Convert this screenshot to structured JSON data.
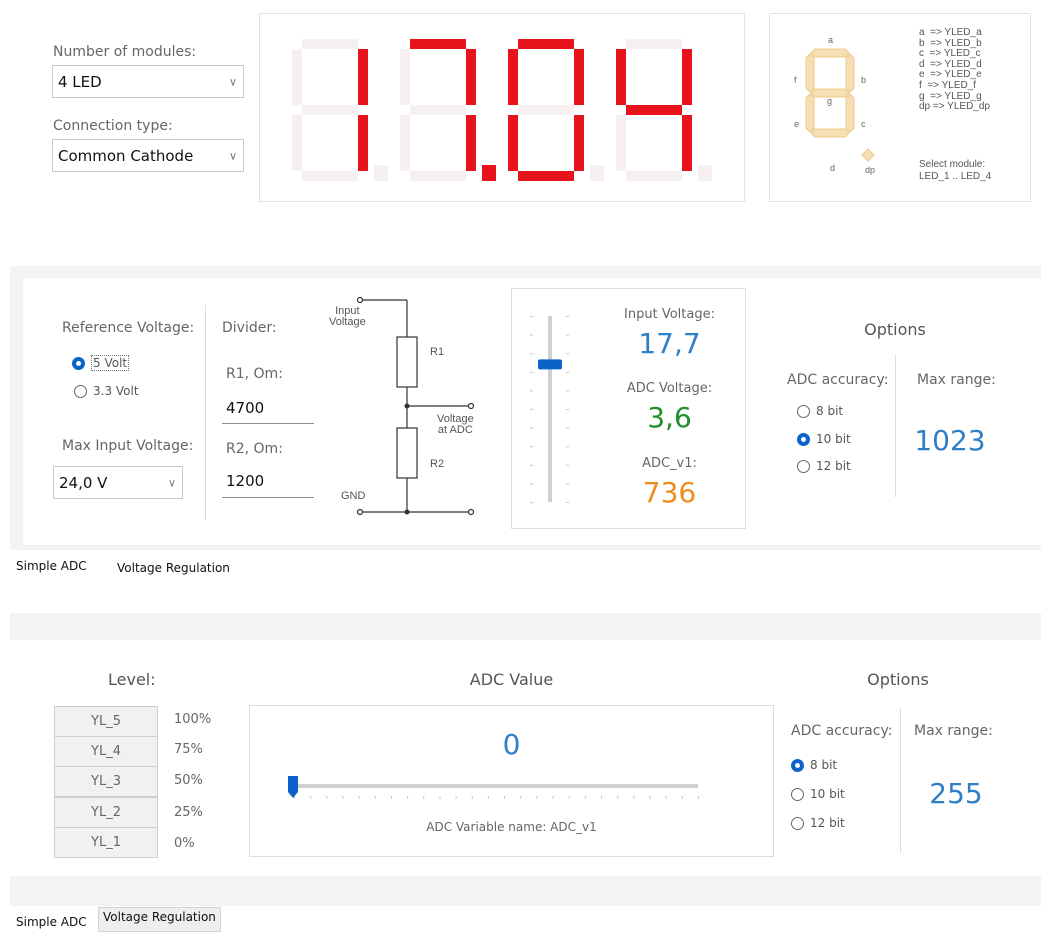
{
  "display_config": {
    "modules_label": "Number of modules:",
    "modules_value": "4 LED",
    "connection_label": "Connection type:",
    "connection_value": "Common Cathode"
  },
  "seven_segment": {
    "display_text": "17.04",
    "active_color": "#e8141b",
    "inactive_color": "#f7f0f0",
    "legend_lines": [
      "a  => YLED_a",
      "b  => YLED_b",
      "c  => YLED_c",
      "d  => YLED_d",
      "e  => YLED_e",
      "f  => YLED_f",
      "g  => YLED_g",
      "dp => YLED_dp"
    ],
    "select_module_label": "Select module:",
    "select_module_range": "LED_1 .. LED_4",
    "diagram_labels": {
      "a": "a",
      "b": "b",
      "c": "c",
      "d": "d",
      "e": "e",
      "f": "f",
      "g": "g",
      "dp": "dp"
    }
  },
  "simple_adc": {
    "ref_voltage_label": "Reference Voltage:",
    "ref_options": [
      {
        "label": "5 Volt",
        "selected": true
      },
      {
        "label": "3.3 Volt",
        "selected": false
      }
    ],
    "max_input_label": "Max Input Voltage:",
    "max_input_value": "24,0 V",
    "divider_label": "Divider:",
    "r1_label": "R1, Om:",
    "r1_value": "4700",
    "r2_label": "R2, Om:",
    "r2_value": "1200",
    "circuit": {
      "input_voltage": "Input\nVoltage",
      "r1": "R1",
      "r2": "R2",
      "voltage_at_adc": "Voltage\nat ADC",
      "gnd": "GND"
    },
    "slider_fraction": 0.74,
    "input_voltage_label": "Input Voltage:",
    "input_voltage_value": "17,7",
    "adc_voltage_label": "ADC Voltage:",
    "adc_voltage_value": "3,6",
    "adc_var_label": "ADC_v1:",
    "adc_var_value": "736",
    "options_title": "Options",
    "accuracy_label": "ADC accuracy:",
    "accuracy_options": [
      {
        "label": "8 bit",
        "selected": false
      },
      {
        "label": "10 bit",
        "selected": true
      },
      {
        "label": "12 bit",
        "selected": false
      }
    ],
    "max_range_label": "Max range:",
    "max_range_value": "1023",
    "colors": {
      "blue": "#2f7fc7",
      "green": "#1f8f2a",
      "orange": "#f08c1c"
    }
  },
  "tabs_1": {
    "simple_adc": "Simple ADC",
    "voltage_regulation": "Voltage Regulation"
  },
  "voltage_regulation": {
    "level_title": "Level:",
    "levels": [
      {
        "name": "YL_5",
        "pct": "100%"
      },
      {
        "name": "YL_4",
        "pct": "75%"
      },
      {
        "name": "YL_3",
        "pct": "50%"
      },
      {
        "name": "YL_2",
        "pct": "25%"
      },
      {
        "name": "YL_1",
        "pct": "0%"
      }
    ],
    "adc_value_title": "ADC Value",
    "adc_value": "0",
    "slider_fraction": 0,
    "variable_name": "ADC Variable name: ADC_v1",
    "options_title": "Options",
    "accuracy_label": "ADC accuracy:",
    "accuracy_options": [
      {
        "label": "8 bit",
        "selected": true
      },
      {
        "label": "10 bit",
        "selected": false
      },
      {
        "label": "12 bit",
        "selected": false
      }
    ],
    "max_range_label": "Max range:",
    "max_range_value": "255"
  },
  "tabs_2": {
    "simple_adc": "Simple ADC",
    "voltage_regulation": "Voltage Regulation"
  }
}
